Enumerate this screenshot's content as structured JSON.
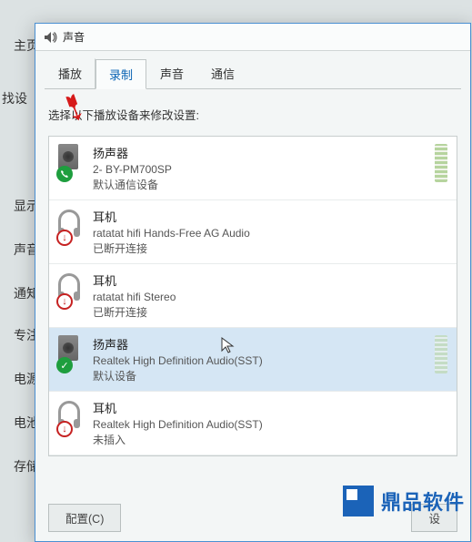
{
  "background": {
    "header_fragment": "主页",
    "search_fragment": "找设",
    "left_menu": [
      "显示",
      "声音",
      "通知",
      "专注",
      "电源",
      "电池",
      "存储"
    ]
  },
  "dialog": {
    "title": "声音",
    "tabs": [
      "播放",
      "录制",
      "声音",
      "通信"
    ],
    "active_tab_index": 1,
    "prompt": "选择以下播放设备来修改设置:"
  },
  "devices": [
    {
      "type": "speaker",
      "name": "扬声器",
      "sub": "2- BY-PM700SP",
      "status_text": "默认通信设备",
      "badge": "phone-green",
      "level": true
    },
    {
      "type": "headphone",
      "name": "耳机",
      "sub": "ratatat hifi Hands-Free AG Audio",
      "status_text": "已断开连接",
      "badge": "down-red",
      "level": false
    },
    {
      "type": "headphone",
      "name": "耳机",
      "sub": "ratatat hifi Stereo",
      "status_text": "已断开连接",
      "badge": "down-red",
      "level": false
    },
    {
      "type": "speaker",
      "name": "扬声器",
      "sub": "Realtek High Definition Audio(SST)",
      "status_text": "默认设备",
      "badge": "check-green",
      "level": true,
      "selected": true
    },
    {
      "type": "headphone",
      "name": "耳机",
      "sub": "Realtek High Definition Audio(SST)",
      "status_text": "未插入",
      "badge": "down-red",
      "level": false
    }
  ],
  "buttons": {
    "configure": "配置(C)",
    "set_default_fragment": "设"
  },
  "watermark": {
    "text": "鼎品软件"
  }
}
